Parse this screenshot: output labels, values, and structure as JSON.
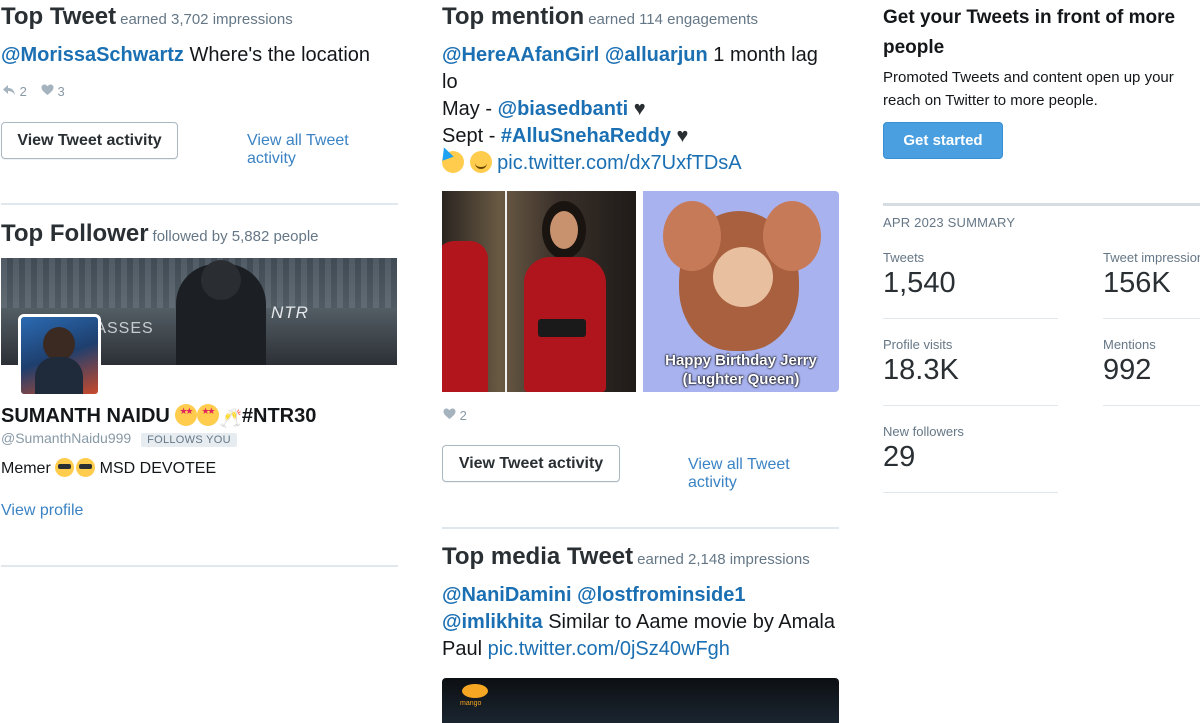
{
  "top_tweet": {
    "title": "Top Tweet",
    "subtitle": "earned 3,702 impressions",
    "mention": "@MorissaSchwartz",
    "text": " Where's the location",
    "retweets": "2",
    "likes": "3",
    "activity_button": "View Tweet activity",
    "all_activity_link": "View all Tweet activity"
  },
  "top_follower": {
    "title": "Top Follower",
    "subtitle": "followed by 5,882 people",
    "banner_text_1": "NTR",
    "banner_text_2": "MASSES",
    "name": "SUMANTH NAIDU",
    "name_suffix": "#NTR30",
    "handle": "@SumanthNaidu999",
    "follows_badge": "FOLLOWS YOU",
    "bio_start": "Memer ",
    "bio_end": " MSD DEVOTEE",
    "view_profile": "View profile"
  },
  "top_mention": {
    "title": "Top mention",
    "subtitle": "earned 114 engagements",
    "mention_1": "@HereAAfanGirl",
    "mention_2": "@alluarjun",
    "text_1": " 1 month lag",
    "text_2": "lo",
    "may_label": "May - ",
    "may_mention": "@biasedbanti",
    "sept_label": "Sept - ",
    "sept_hashtag": "#AlluSnehaReddy",
    "pic_link": "pic.twitter.com/dx7UxfTDsA",
    "image_caption_1": "Happy Birthday Jerry",
    "image_caption_2": "(Lughter Queen)",
    "likes": "2",
    "activity_button": "View Tweet activity",
    "all_activity_link": "View all Tweet activity"
  },
  "top_media": {
    "title": "Top media Tweet",
    "subtitle": "earned 2,148 impressions",
    "mention_1": "@NaniDamini",
    "mention_2": "@lostfrominside1",
    "mention_3": "@imlikhita",
    "text_1": " Similar to Aame movie by Amala",
    "text_2": "Paul ",
    "pic_link": "pic.twitter.com/0jSz40wFgh",
    "image_logo": "mango"
  },
  "promo": {
    "title": "Get your Tweets in front of more people",
    "body": "Promoted Tweets and content open up your reach on Twitter to more people.",
    "button": "Get started"
  },
  "summary": {
    "heading": "APR 2023 SUMMARY",
    "stats": [
      {
        "label": "Tweets",
        "value": "1,540"
      },
      {
        "label": "Tweet impressions",
        "value": "156K"
      },
      {
        "label": "Profile visits",
        "value": "18.3K"
      },
      {
        "label": "Mentions",
        "value": "992"
      },
      {
        "label": "New followers",
        "value": "29"
      }
    ]
  },
  "colors": {
    "link": "#1b6fb3",
    "primary_button": "#4a9fe0",
    "divider": "#e1e8ed"
  }
}
